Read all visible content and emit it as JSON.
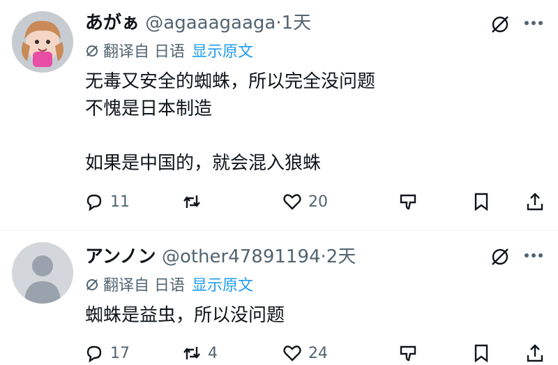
{
  "tweets": [
    {
      "display_name": "あがぁ",
      "handle": "@agaaagaaga",
      "time": "·1天",
      "translated_from": "翻译自 日语",
      "show_original": "显示原文",
      "text_lines": [
        "无毒又安全的蜘蛛，所以完全没问题",
        "不愧是日本制造",
        "",
        "如果是中国的，就会混入狼蛛"
      ],
      "replies": "11",
      "retweets": "",
      "likes": "20"
    },
    {
      "display_name": "アンノン",
      "handle": "@other47891194",
      "time": "·2天",
      "translated_from": "翻译自 日语",
      "show_original": "显示原文",
      "text_lines": [
        "蜘蛛是益虫，所以没问题"
      ],
      "replies": "17",
      "retweets": "4",
      "likes": "24"
    }
  ],
  "colors": {
    "text": "#0f1419",
    "secondary": "#536471",
    "link": "#1d9bf0"
  },
  "icons": [
    "translate-icon",
    "reply-icon",
    "retweet-icon",
    "like-icon",
    "downvote-icon",
    "bookmark-icon",
    "share-icon",
    "grok-icon",
    "more-icon"
  ]
}
